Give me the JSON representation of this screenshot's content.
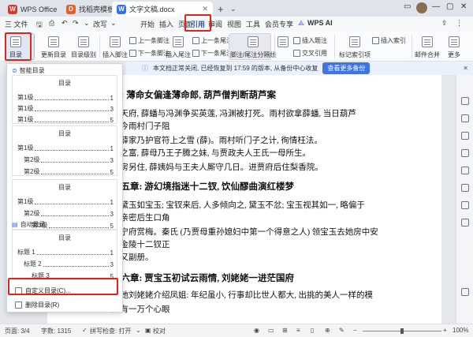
{
  "tabs": [
    {
      "label": "WPS Office",
      "logo": "W",
      "logo_color": "#d9382b"
    },
    {
      "label": "找稻壳模板",
      "logo": "D",
      "logo_color": "#e55d2b"
    },
    {
      "label": "文字文稿.docx",
      "logo": "W",
      "logo_color": "#2f6ff0"
    }
  ],
  "menu": {
    "file": "三 文件",
    "undo_more": "改写",
    "items": [
      "开始",
      "插入",
      "页面",
      "引用",
      "审阅",
      "视图",
      "工具",
      "会员专享"
    ],
    "active": "引用",
    "ai": "WPS AI"
  },
  "ribbon": {
    "toc": "目录",
    "update_toc": "更新目录",
    "toc_level": "目录级别",
    "insert_footnote": "插入脚注",
    "prev_footnote": "上一条脚注",
    "next_footnote": "下一条脚注",
    "insert_endnote": "插入尾注",
    "prev_endnote": "上一条尾注",
    "next_endnote": "下一条尾注",
    "note_split": "脚注/尾注分隔线",
    "insert_caption": "插入题注",
    "cross_ref": "交叉引用",
    "mark_index": "标记索引项",
    "insert_index": "插入索引",
    "mail_merge": "邮件合并",
    "more": "更多"
  },
  "notification": {
    "text": "本文档正常关闭, 已经恢复到 17:59 的版本, 从备份中心收复",
    "button": "查看更多备份"
  },
  "document": {
    "lines": [
      {
        "text": "章: 薄命女偏逢薄命郎, 葫芦僧判断葫芦案",
        "heading": true
      },
      {
        "text": "只天府, 薛蟠与冯渊争买英莲, 冯渊被打死。雨村欲拿薛蟠, 当日葫芦",
        "heading": false
      },
      {
        "text": "如今雨村门子阻",
        "heading": false
      },
      {
        "text": "说薛家乃护官符上之雪 (薛)。雨村听门子之计, 徇情枉法。",
        "heading": false
      },
      {
        "text": "万之富, 薛母乃王子腾之妹, 与贾政夫人王氏一母所生。",
        "heading": false
      },
      {
        "text": "家房另住, 薛姨妈与王夫人厮守几日。进贾府后住梨香院。",
        "heading": false
      },
      {
        "text": "第五章: 游幻境指迷十二钗, 饮仙醪曲演红楼梦",
        "heading": true
      },
      {
        "text": "爱黛玉如宝玉; 宝钗来后, 人多倾向之, 黛玉不忿; 宝玉视其如一, 略偏于",
        "heading": false
      },
      {
        "text": "国亲密后生口角",
        "heading": false
      },
      {
        "text": "去宁府赏梅。秦氏 (乃贾母重孙媳妇中第一个得意之人) 领宝玉去她房中安",
        "heading": false
      },
      {
        "text": "看金陵十二钗正",
        "heading": false
      },
      {
        "text": "及又副册。",
        "heading": false
      },
      {
        "text": "第六章: 贾宝玉初试云雨情, 刘姥姥一进茫国府",
        "heading": true
      },
      {
        "text": "的她刘姥姥介绍凤姐: 年纪虽小, 行事却比世人都大, 出挑的美人一样的模",
        "heading": false
      },
      {
        "text": "要有一万个心眼",
        "heading": false
      }
    ]
  },
  "dropdown": {
    "section_none": "智能目录",
    "cards": [
      {
        "title": "目录",
        "rows": [
          {
            "label": "第1级",
            "page": "1"
          },
          {
            "label": "第1级",
            "page": "3"
          },
          {
            "label": "第1级",
            "page": "5"
          }
        ]
      },
      {
        "title": "目录",
        "rows": [
          {
            "label": "第1级",
            "page": "1"
          },
          {
            "label": "第2级",
            "page": "3"
          },
          {
            "label": "第2级",
            "page": "5"
          }
        ]
      },
      {
        "title": "目录",
        "rows": [
          {
            "label": "第1级",
            "page": "1"
          },
          {
            "label": "第2级",
            "page": "3"
          },
          {
            "label": "第3级",
            "page": "5"
          }
        ]
      }
    ],
    "section_auto": "自动目录",
    "auto_card": {
      "title": "目录",
      "rows": [
        {
          "label": "标题 1",
          "page": "1"
        },
        {
          "label": "标题 2",
          "page": "3"
        },
        {
          "label": "标题 3",
          "page": "5"
        }
      ]
    },
    "custom": "自定义目录(C)...",
    "delete": "删除目录(R)"
  },
  "status": {
    "page": "页面: 3/4",
    "words": "字数: 1315",
    "spell": "拼写检查: 打开",
    "proof": "校对",
    "zoom": "100%"
  }
}
